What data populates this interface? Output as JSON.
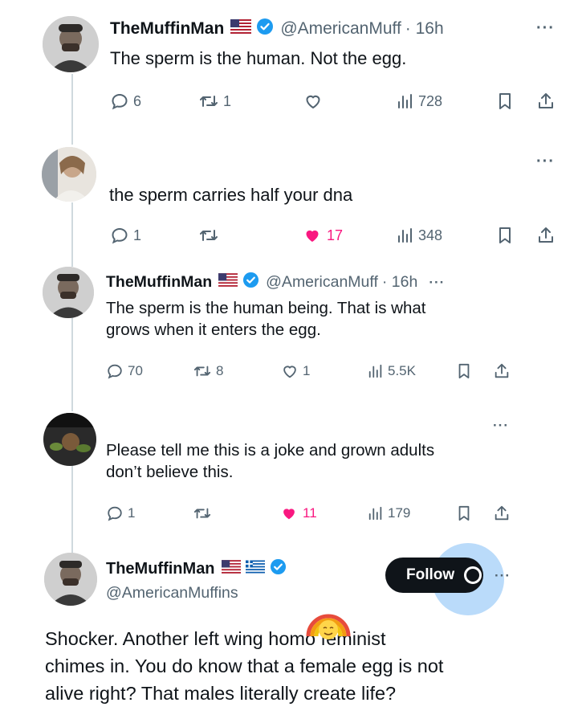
{
  "tweets": [
    {
      "name": "TheMuffinMan",
      "handle": "@AmericanMuff",
      "time": "· 16h",
      "more": "···",
      "text": "The sperm is the human. Not the egg.",
      "reply_count": "6",
      "retweet_count": "1",
      "like_count": "",
      "view_count": "728",
      "liked": false
    },
    {
      "more": "···",
      "text": "the sperm carries half your dna",
      "reply_count": "1",
      "retweet_count": "",
      "like_count": "17",
      "view_count": "348",
      "liked": true
    },
    {
      "name": "TheMuffinMan",
      "handle": "@AmericanMuff",
      "time": "· 16h",
      "more": "···",
      "text_line1": "The sperm is the human being. That is what",
      "text_line2": "grows when it enters the egg.",
      "reply_count": "70",
      "retweet_count": "8",
      "like_count": "1",
      "view_count": "5.5K",
      "liked": false
    },
    {
      "more": "···",
      "text_line1": "Please tell me this is a joke and grown adults",
      "text_line2": "don’t believe this.",
      "reply_count": "1",
      "retweet_count": "",
      "like_count": "11",
      "view_count": "179",
      "liked": true
    }
  ],
  "main_post": {
    "name": "TheMuffinMan",
    "handle": "@AmericanMuffins",
    "follow_label": "Follow",
    "more": "···",
    "text_line1": "Shocker. Another left wing homo feminist",
    "text_line2": "chimes in. You do know that a female egg is not",
    "text_line3": "alive right? That males literally create life?"
  },
  "colors": {
    "like_pink": "#f91880",
    "verified_blue": "#1d9bf0",
    "muted_gray": "#536471"
  },
  "icons": [
    "reply-icon",
    "retweet-icon",
    "like-icon",
    "views-icon",
    "bookmark-icon",
    "share-icon",
    "verified-icon",
    "us-flag-icon",
    "greek-flag-icon",
    "more-icon"
  ]
}
